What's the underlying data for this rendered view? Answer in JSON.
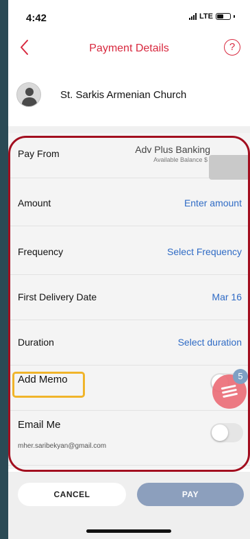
{
  "status_bar": {
    "time": "4:42",
    "network": "LTE"
  },
  "nav": {
    "title": "Payment Details",
    "help_label": "?"
  },
  "payee": {
    "name": "St. Sarkis Armenian Church"
  },
  "form": {
    "pay_from": {
      "label": "Pay From",
      "account": "Adv Plus Banking",
      "balance_label": "Available Balance $"
    },
    "amount": {
      "label": "Amount",
      "value": "Enter amount"
    },
    "frequency": {
      "label": "Frequency",
      "value": "Select Frequency"
    },
    "first_delivery": {
      "label": "First Delivery Date",
      "value": "Mar 16"
    },
    "duration": {
      "label": "Duration",
      "value": "Select duration"
    },
    "memo": {
      "label": "Add Memo"
    },
    "email": {
      "label": "Email Me",
      "address": "mher.saribekyan@gmail.com"
    }
  },
  "fab": {
    "badge_count": "5"
  },
  "footer": {
    "cancel_label": "CANCEL",
    "pay_label": "PAY"
  },
  "colors": {
    "accent": "#d8283e",
    "link": "#2f6bc5",
    "pay_button": "#8c9fbd",
    "highlight_ring": "#a20e1f",
    "highlight_memo": "#f0b42a"
  }
}
